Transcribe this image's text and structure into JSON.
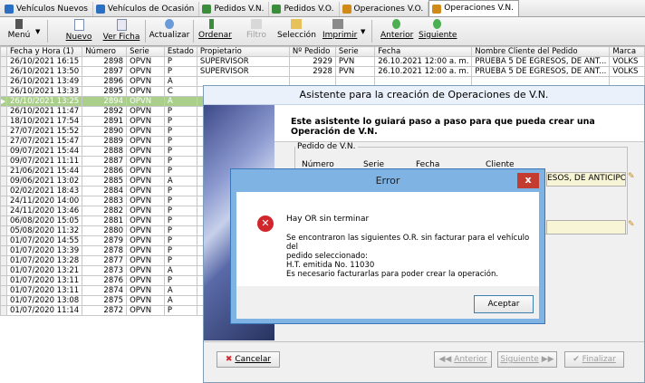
{
  "tabs": [
    {
      "label": "Vehículos Nuevos",
      "active": false,
      "color": "#2b6fc2"
    },
    {
      "label": "Vehículos de Ocasión",
      "active": false,
      "color": "#2b6fc2"
    },
    {
      "label": "Pedidos V.N.",
      "active": false,
      "color": "#3b8c3b"
    },
    {
      "label": "Pedidos V.O.",
      "active": false,
      "color": "#3b8c3b"
    },
    {
      "label": "Operaciones V.O.",
      "active": false,
      "color": "#d08a18"
    },
    {
      "label": "Operaciones V.N.",
      "active": true,
      "color": "#d08a18"
    }
  ],
  "toolbar": {
    "menu": "Menú",
    "nuevo": "Nuevo",
    "ver_ficha": "Ver Ficha",
    "actualizar": "Actualizar",
    "ordenar": "Ordenar",
    "filtro": "Filtro",
    "seleccion": "Selección",
    "imprimir": "Imprimir",
    "anterior": "Anterior",
    "siguiente": "Siguiente"
  },
  "grid": {
    "columns": [
      "Fecha y Hora (1)",
      "Número",
      "Serie",
      "Estado",
      "Propietario",
      "Nº Pedido",
      "Serie",
      "Fecha",
      "Nombre Cliente del Pedido",
      "Marca"
    ],
    "rows": [
      [
        "26/10/2021 16:15",
        "2898",
        "OPVN",
        "P",
        "SUPERVISOR",
        "2929",
        "PVN",
        "26.10.2021 12:00 a. m.",
        "PRUEBA 5 DE EGRESOS, DE ANT...",
        "VOLKS"
      ],
      [
        "26/10/2021 13:50",
        "2897",
        "OPVN",
        "P",
        "SUPERVISOR",
        "2928",
        "PVN",
        "26.10.2021 12:00 a. m.",
        "PRUEBA 5 DE EGRESOS, DE ANT...",
        "VOLKS"
      ],
      [
        "26/10/2021 13:49",
        "2896",
        "OPVN",
        "A",
        "",
        "",
        "",
        "",
        "",
        ""
      ],
      [
        "26/10/2021 13:33",
        "2895",
        "OPVN",
        "C",
        "",
        "",
        "",
        "",
        "",
        ""
      ],
      [
        "26/10/2021 13:25",
        "2894",
        "OPVN",
        "A",
        "",
        "",
        "",
        "",
        "",
        ""
      ],
      [
        "26/10/2021 11:47",
        "2892",
        "OPVN",
        "P",
        "",
        "",
        "",
        "",
        "",
        ""
      ],
      [
        "18/10/2021 17:54",
        "2891",
        "OPVN",
        "P",
        "",
        "",
        "",
        "",
        "",
        ""
      ],
      [
        "27/07/2021 15:52",
        "2890",
        "OPVN",
        "P",
        "",
        "",
        "",
        "",
        "",
        ""
      ],
      [
        "27/07/2021 15:47",
        "2889",
        "OPVN",
        "P",
        "",
        "",
        "",
        "",
        "",
        ""
      ],
      [
        "09/07/2021 15:44",
        "2888",
        "OPVN",
        "P",
        "",
        "",
        "",
        "",
        "",
        ""
      ],
      [
        "09/07/2021 11:11",
        "2887",
        "OPVN",
        "P",
        "",
        "",
        "",
        "",
        "",
        ""
      ],
      [
        "21/06/2021 15:44",
        "2886",
        "OPVN",
        "P",
        "",
        "",
        "",
        "",
        "",
        ""
      ],
      [
        "09/06/2021 13:02",
        "2885",
        "OPVN",
        "A",
        "",
        "",
        "",
        "",
        "",
        ""
      ],
      [
        "02/02/2021 18:43",
        "2884",
        "OPVN",
        "P",
        "",
        "",
        "",
        "",
        "",
        ""
      ],
      [
        "24/11/2020 14:00",
        "2883",
        "OPVN",
        "P",
        "",
        "",
        "",
        "",
        "",
        ""
      ],
      [
        "24/11/2020 13:46",
        "2882",
        "OPVN",
        "P",
        "",
        "",
        "",
        "",
        "",
        ""
      ],
      [
        "06/08/2020 15:05",
        "2881",
        "OPVN",
        "P",
        "",
        "",
        "",
        "",
        "",
        ""
      ],
      [
        "05/08/2020 11:32",
        "2880",
        "OPVN",
        "P",
        "",
        "",
        "",
        "",
        "",
        ""
      ],
      [
        "01/07/2020 14:55",
        "2879",
        "OPVN",
        "P",
        "",
        "",
        "",
        "",
        "",
        ""
      ],
      [
        "01/07/2020 13:39",
        "2878",
        "OPVN",
        "P",
        "",
        "",
        "",
        "",
        "",
        ""
      ],
      [
        "01/07/2020 13:28",
        "2877",
        "OPVN",
        "P",
        "",
        "",
        "",
        "",
        "",
        ""
      ],
      [
        "01/07/2020 13:21",
        "2873",
        "OPVN",
        "A",
        "",
        "",
        "",
        "",
        "",
        ""
      ],
      [
        "01/07/2020 13:11",
        "2876",
        "OPVN",
        "P",
        "",
        "",
        "",
        "",
        "",
        ""
      ],
      [
        "01/07/2020 13:11",
        "2874",
        "OPVN",
        "A",
        "",
        "",
        "",
        "",
        "",
        ""
      ],
      [
        "01/07/2020 13:08",
        "2875",
        "OPVN",
        "A",
        "",
        "",
        "",
        "",
        "",
        ""
      ],
      [
        "01/07/2020 11:14",
        "2872",
        "OPVN",
        "P",
        "",
        "",
        "",
        "",
        "",
        ""
      ]
    ],
    "selected_row": 4
  },
  "wizard": {
    "title": "Asistente para la creación de Operaciones de V.N.",
    "heading": "Este asistente lo guiará paso a paso para que pueda crear una Operación de V.N.",
    "group_label": "Pedido de V.N.",
    "col_numero": "Número",
    "col_serie": "Serie",
    "col_fecha": "Fecha",
    "col_cliente": "Cliente",
    "cliente_value": "ESOS, DE ANTICIPOS",
    "cancel": "Cancelar",
    "prev": "Anterior",
    "next": "Siguiente",
    "finish": "Finalizar"
  },
  "error": {
    "title": "Error",
    "close": "x",
    "line1": "Hay OR sin terminar",
    "line2": "Se encontraron las siguientes O.R. sin facturar para el vehículo del",
    "line3": "pedido seleccionado:",
    "line4": "H.T. emitida No. 11030",
    "line5": "Es necesario facturarlas para poder crear la operación.",
    "ok": "Aceptar"
  }
}
